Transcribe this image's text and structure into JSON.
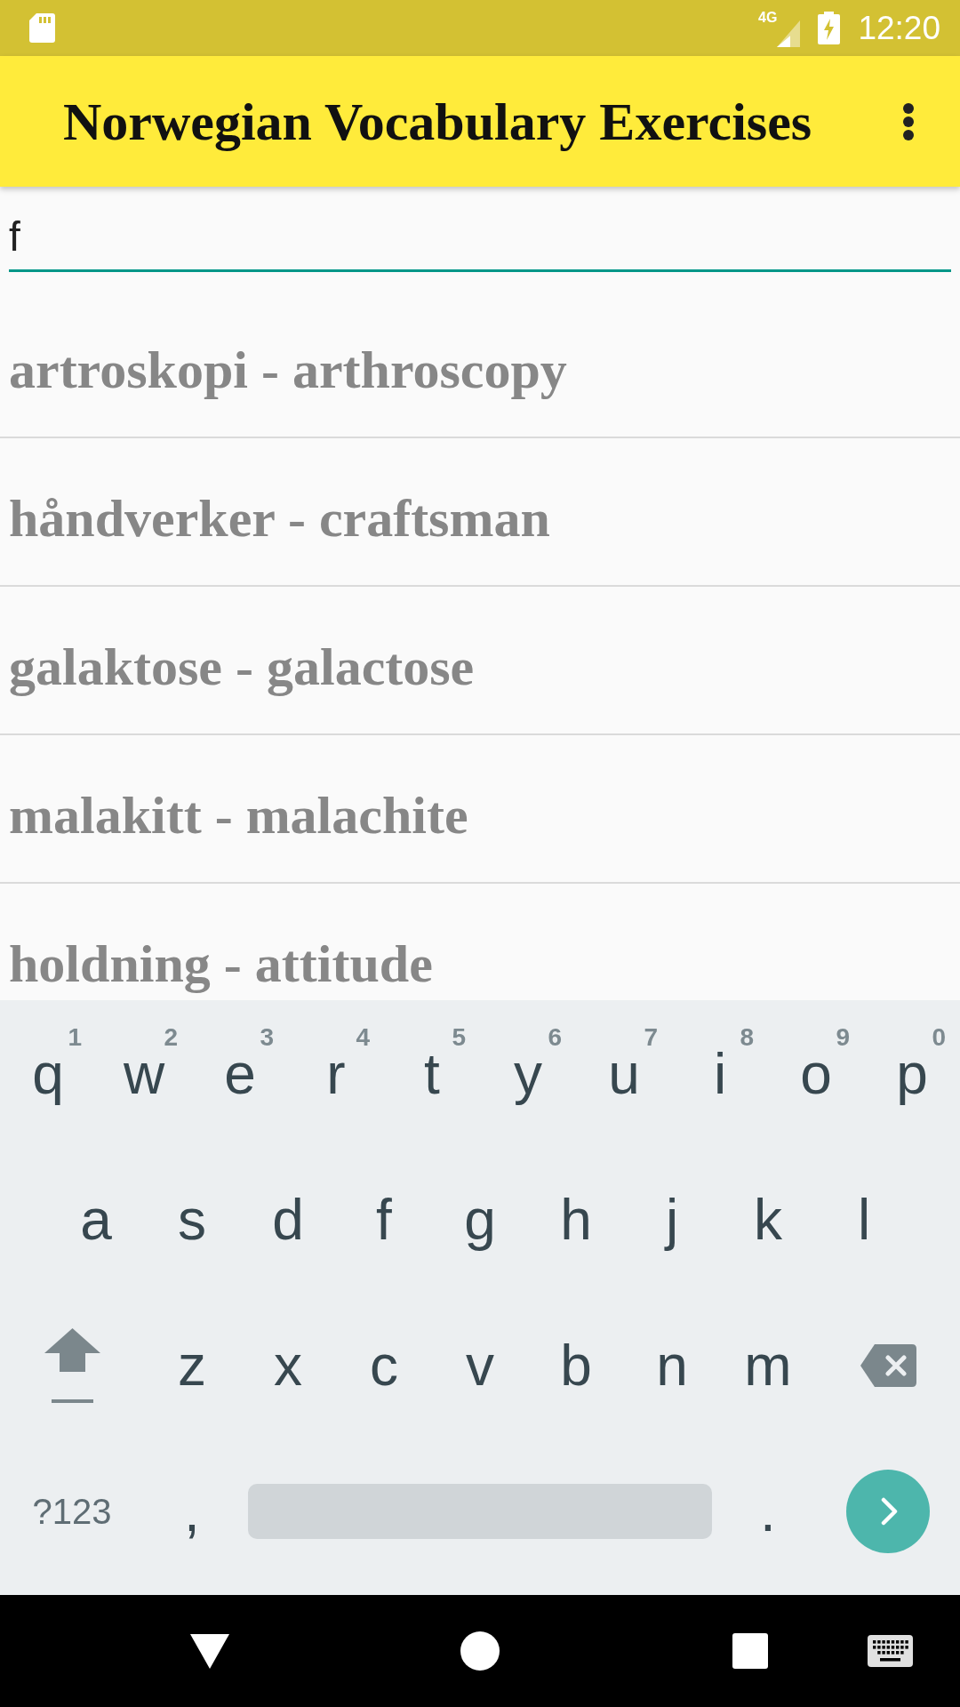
{
  "status_bar": {
    "network": "4G",
    "time": "12:20"
  },
  "app_bar": {
    "title": "Norwegian Vocabulary Exercises"
  },
  "search_field": {
    "value": "f"
  },
  "word_list": [
    "artroskopi - arthroscopy",
    "håndverker - craftsman",
    "galaktose - galactose",
    "malakitt - malachite",
    "holdning - attitude"
  ],
  "keyboard": {
    "letter_rows": [
      [
        {
          "kind": "letter",
          "label": "q",
          "hint": "1"
        },
        {
          "kind": "letter",
          "label": "w",
          "hint": "2"
        },
        {
          "kind": "letter",
          "label": "e",
          "hint": "3"
        },
        {
          "kind": "letter",
          "label": "r",
          "hint": "4"
        },
        {
          "kind": "letter",
          "label": "t",
          "hint": "5"
        },
        {
          "kind": "letter",
          "label": "y",
          "hint": "6"
        },
        {
          "kind": "letter",
          "label": "u",
          "hint": "7"
        },
        {
          "kind": "letter",
          "label": "i",
          "hint": "8"
        },
        {
          "kind": "letter",
          "label": "o",
          "hint": "9"
        },
        {
          "kind": "letter",
          "label": "p",
          "hint": "0"
        }
      ],
      [
        {
          "kind": "letter",
          "label": "a"
        },
        {
          "kind": "letter",
          "label": "s"
        },
        {
          "kind": "letter",
          "label": "d"
        },
        {
          "kind": "letter",
          "label": "f"
        },
        {
          "kind": "letter",
          "label": "g"
        },
        {
          "kind": "letter",
          "label": "h"
        },
        {
          "kind": "letter",
          "label": "j"
        },
        {
          "kind": "letter",
          "label": "k"
        },
        {
          "kind": "letter",
          "label": "l"
        }
      ],
      [
        {
          "kind": "shift"
        },
        {
          "kind": "letter",
          "label": "z"
        },
        {
          "kind": "letter",
          "label": "x"
        },
        {
          "kind": "letter",
          "label": "c"
        },
        {
          "kind": "letter",
          "label": "v"
        },
        {
          "kind": "letter",
          "label": "b"
        },
        {
          "kind": "letter",
          "label": "n"
        },
        {
          "kind": "letter",
          "label": "m"
        },
        {
          "kind": "backspace"
        }
      ]
    ],
    "bottom_row": {
      "symbols_key": "?123",
      "comma_key": ",",
      "period_key": "."
    }
  }
}
